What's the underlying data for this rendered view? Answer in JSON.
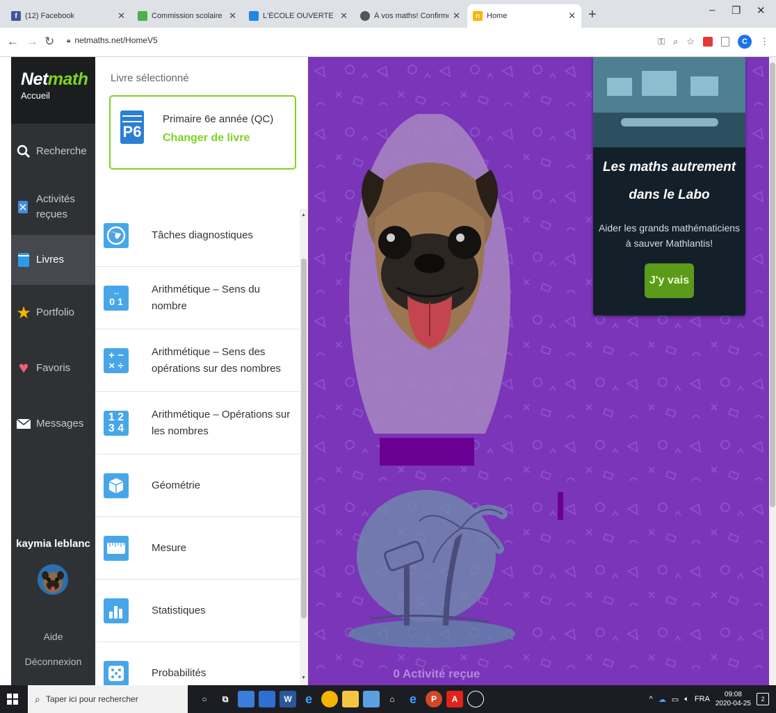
{
  "browser": {
    "tabs": [
      {
        "title": "(12) Facebook",
        "favicon_color": "#3b5998",
        "favicon_glyph": "f"
      },
      {
        "title": "Commission scolaire des Trois-La",
        "favicon_color": "#4caf50",
        "favicon_glyph": ""
      },
      {
        "title": "L'ÉCOLE OUVERTE – PRIMAIRE",
        "favicon_color": "#1e88e5",
        "favicon_glyph": ""
      },
      {
        "title": "À vos maths! Confirmé - Scolab",
        "favicon_color": "#555555",
        "favicon_glyph": ""
      },
      {
        "title": "Home",
        "favicon_color": "#ffb300",
        "favicon_glyph": "n"
      }
    ],
    "url": "netmaths.net/HomeV5",
    "profile_initial": "C"
  },
  "sidebar": {
    "brand_net": "Net",
    "brand_math": "math",
    "home_label": "Accueil",
    "items": [
      {
        "label": "Recherche",
        "icon": "search-icon"
      },
      {
        "label": "Activités reçues",
        "icon": "activities-icon"
      },
      {
        "label": "Livres",
        "icon": "book-icon",
        "active": true
      },
      {
        "label": "Portfolio",
        "icon": "star-icon"
      },
      {
        "label": "Favoris",
        "icon": "heart-icon"
      },
      {
        "label": "Messages",
        "icon": "envelope-icon"
      }
    ],
    "username": "kaymia leblanc",
    "help_label": "Aide",
    "logout_label": "Déconnexion"
  },
  "book": {
    "selected_header": "Livre sélectionné",
    "icon_label": "P6",
    "name": "Primaire 6e année (QC)",
    "change_label": "Changer de livre",
    "chapters": [
      {
        "title": "Tâches diagnostiques",
        "icon": "globe-icon",
        "glyph": "◉"
      },
      {
        "title": "Arithmétique – Sens du nombre",
        "icon": "number-line-icon",
        "glyph": "0 1"
      },
      {
        "title": "Arithmétique – Sens des opérations sur des nombres",
        "icon": "operations-icon",
        "glyph": "+ −\n× ÷"
      },
      {
        "title": "Arithmétique – Opérations sur les nombres",
        "icon": "digits-icon",
        "glyph": "1 2\n3 4"
      },
      {
        "title": "Géométrie",
        "icon": "cube-icon",
        "glyph": "⬡"
      },
      {
        "title": "Mesure",
        "icon": "ruler-icon",
        "glyph": "▭"
      },
      {
        "title": "Statistiques",
        "icon": "bar-chart-icon",
        "glyph": "▮▮"
      },
      {
        "title": "Probabilités",
        "icon": "dice-icon",
        "glyph": "⁙"
      }
    ]
  },
  "main": {
    "activities_label": "0 Activité reçue",
    "labo": {
      "title_line1": "Les maths autrement",
      "title_line2": "dans le Labo",
      "desc_line1": "Aider les grands mathématiciens",
      "desc_line2": "à sauver Mathlantis!",
      "button_label": "J'y vais"
    }
  },
  "taskbar": {
    "search_placeholder": "Taper ici pour rechercher",
    "language": "FRA",
    "time": "09:08",
    "date": "2020-04-25",
    "notifications": "2"
  },
  "colors": {
    "accent_green": "#7ed321",
    "main_purple": "#7a35b8",
    "sidebar_dark": "#2f3235",
    "chapter_icon_blue": "#48a6e8"
  }
}
